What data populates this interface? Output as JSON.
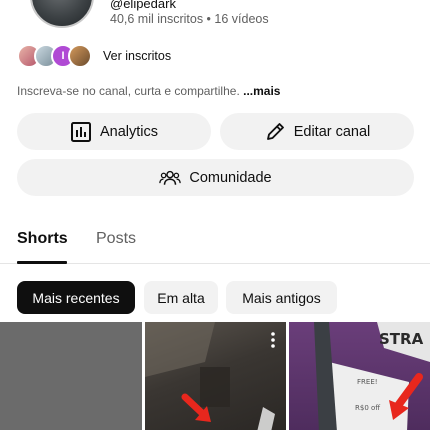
{
  "channel": {
    "handle": "@elipedark",
    "stats": "40,6 mil inscritos • 16 vídeos",
    "subscribers_link": "Ver inscritos",
    "subscriber_avatar_initial": "I",
    "description": "Inscreva-se no canal, curta e compartilhe.",
    "description_more": "...mais"
  },
  "actions": {
    "analytics": "Analytics",
    "edit_channel": "Editar canal",
    "community": "Comunidade"
  },
  "tabs": {
    "shorts": "Shorts",
    "posts": "Posts"
  },
  "filters": {
    "recent": "Mais recentes",
    "trending": "Em alta",
    "oldest": "Mais antigos"
  },
  "thumbnails": {
    "third_sign_top": "FREE!",
    "third_sign_bottom": "R$0 off",
    "third_banner": "STRA"
  },
  "colors": {
    "accent_arrow": "#e8271d",
    "chip_active_bg": "#0f0f0f",
    "chip_bg": "#f2f2f2"
  }
}
